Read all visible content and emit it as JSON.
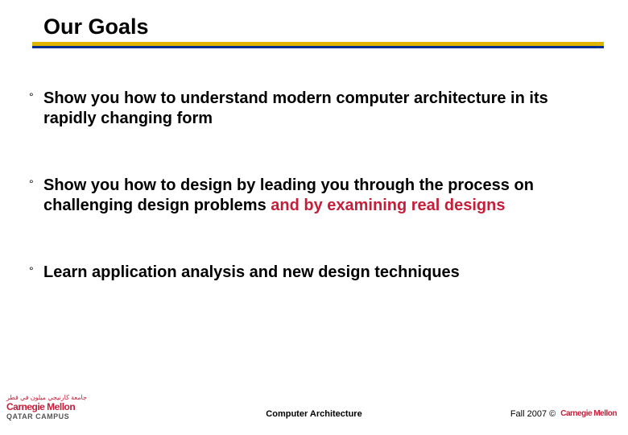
{
  "title": "Our Goals",
  "bullet_mark": "°",
  "bullets": {
    "b1": "Show you how to understand modern computer architecture in its rapidly changing form",
    "b2_pre": "Show you how to design by leading you through the process on challenging design problems ",
    "b2_hi": "and by examining real designs",
    "b3": "Learn application analysis and new design techniques"
  },
  "footer": {
    "center": "Computer Architecture",
    "right": "Fall 2007 ©"
  },
  "logo": {
    "arabic": "جامعة كارنيجي ميلون في قطر",
    "cm": "Carnegie Mellon",
    "qatar": "QATAR CAMPUS",
    "right_cm": "Carnegie Mellon"
  }
}
